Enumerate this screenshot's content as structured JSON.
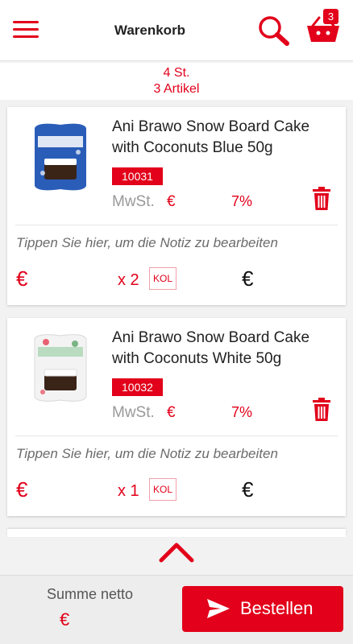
{
  "header": {
    "title": "Warenkorb",
    "cart_count": "3"
  },
  "summary": {
    "pieces": "4 St.",
    "articles": "3 Artikel"
  },
  "items": [
    {
      "name": "Ani Brawo Snow Board Cake with Coconuts Blue 50g",
      "sku": "10031",
      "vat_label": "MwSt.",
      "vat_currency": "€",
      "vat_rate": "7%",
      "note_placeholder": "Tippen Sie hier, um die Notiz zu bearbeiten",
      "price_currency": "€",
      "quantity": "x 2",
      "unit": "KOL",
      "total_currency": "€",
      "wrapper_color": "#2a5db8"
    },
    {
      "name": "Ani Brawo Snow Board Cake with Coconuts White 50g",
      "sku": "10032",
      "vat_label": "MwSt.",
      "vat_currency": "€",
      "vat_rate": "7%",
      "note_placeholder": "Tippen Sie hier, um die Notiz zu bearbeiten",
      "price_currency": "€",
      "quantity": "x 1",
      "unit": "KOL",
      "total_currency": "€",
      "wrapper_color": "#f0f0f0"
    }
  ],
  "footer": {
    "sum_label": "Summe netto",
    "sum_currency": "€",
    "order_button": "Bestellen"
  },
  "icons": {
    "menu": "menu-icon",
    "search": "search-icon",
    "cart": "cart-icon",
    "trash": "trash-icon",
    "scroll_up": "chevron-up-icon",
    "send": "send-icon"
  },
  "colors": {
    "accent": "#e2001a",
    "text": "#222222",
    "muted": "#999999"
  }
}
